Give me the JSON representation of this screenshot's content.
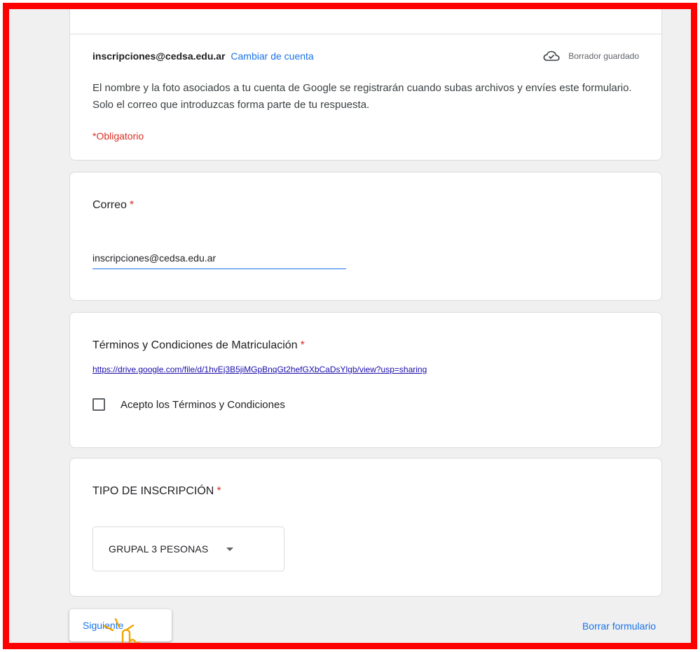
{
  "header": {
    "account_email": "inscripciones@cedsa.edu.ar",
    "switch_account": "Cambiar de cuenta",
    "draft_status": "Borrador guardado",
    "draft_icon": "cloud-check-icon",
    "notice": "El nombre y la foto asociados a tu cuenta de Google se registrarán cuando subas archivos y envíes este formulario. Solo el correo que introduzcas forma parte de tu respuesta.",
    "required_note": "*Obligatorio"
  },
  "email_question": {
    "title": "Correo",
    "required_mark": "*",
    "value": "inscripciones@cedsa.edu.ar"
  },
  "terms_question": {
    "title": "Términos y Condiciones de Matriculación",
    "required_mark": "*",
    "link": "https://drive.google.com/file/d/1hvEj3B5jiMGpBnqGt2hefGXbCaDsYlgb/view?usp=sharing",
    "checkbox_label": "Acepto los Términos y Condiciones",
    "checked": false
  },
  "type_question": {
    "title": "TIPO DE INSCRIPCIÓN",
    "required_mark": "*",
    "selected": "GRUPAL 3 PESONAS",
    "caret_icon": "dropdown-caret-icon"
  },
  "footer": {
    "next_label": "Siguiente",
    "clear_label": "Borrar formulario",
    "cursor_icon": "hand-pointer-icon"
  },
  "colors": {
    "accent": "#1a73e8",
    "required": "#d93025",
    "frame": "#ff0000",
    "cursor": "#f0a500"
  }
}
